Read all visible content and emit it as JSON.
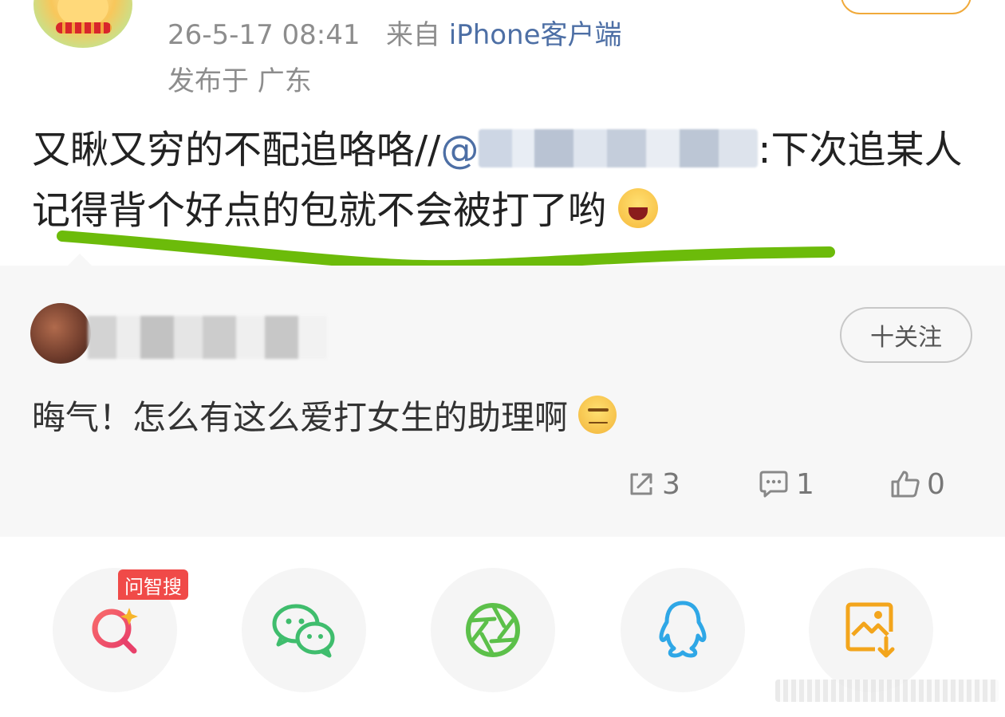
{
  "post": {
    "timestamp": "26-5-17 08:41",
    "source_prefix": "来自",
    "source_client": "iPhone客户端",
    "location": "发布于 广东",
    "text_part1": "又瞅又穷的不配追咯咯//",
    "mention_prefix": "@",
    "text_part2": ":下次追某人记得背个好点的包就不会被打了哟"
  },
  "repost": {
    "follow_label": "十关注",
    "comment_text": "晦气！怎么有这么爱打女生的助理啊",
    "reposts": "3",
    "comments": "1",
    "likes": "0"
  },
  "share": {
    "badge": "问智搜",
    "buttons": [
      "smart-search",
      "wechat",
      "moments",
      "qq",
      "save-image"
    ]
  },
  "colors": {
    "link": "#4d6fa5",
    "underline": "#6cbb0a",
    "badge": "#f04a48",
    "search_icon": "#f0535b",
    "wechat": "#3fbd6d",
    "moments": "#5cc04a",
    "qq": "#2fa7e6",
    "save": "#f3a51c"
  }
}
